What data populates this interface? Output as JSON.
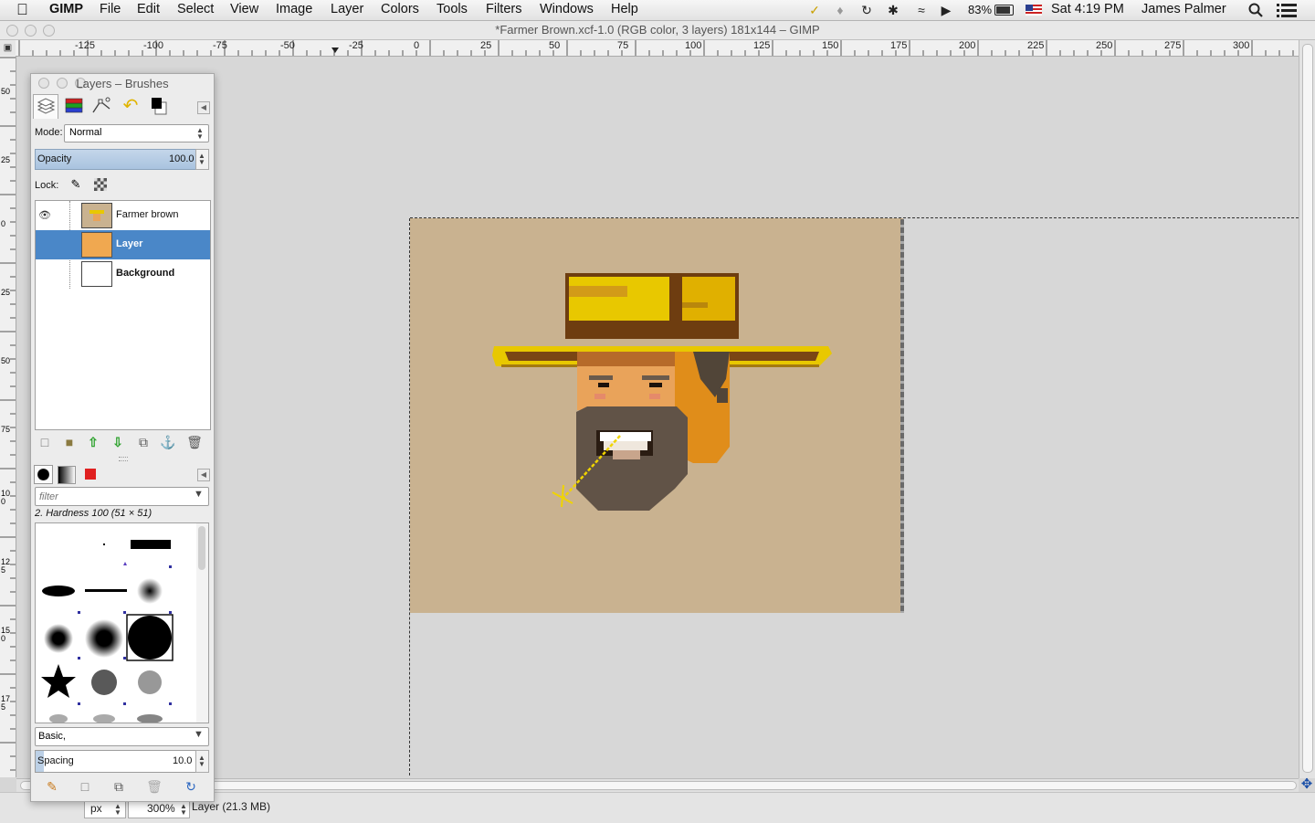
{
  "menubar": {
    "app": "GIMP",
    "items": [
      "File",
      "Edit",
      "Select",
      "View",
      "Image",
      "Layer",
      "Colors",
      "Tools",
      "Filters",
      "Windows",
      "Help"
    ],
    "battery": "83%",
    "clock": "Sat 4:19 PM",
    "user": "James Palmer"
  },
  "window": {
    "title": "*Farmer Brown.xcf-1.0 (RGB color, 3 layers) 181x144 – GIMP"
  },
  "ruler": {
    "labels": [
      "-125",
      "-100",
      "-75",
      "-50",
      "-25",
      "0",
      "25",
      "50",
      "75",
      "100",
      "125",
      "150",
      "175",
      "200",
      "225",
      "250",
      "275",
      "300"
    ],
    "vertical_labels": [
      "50",
      "25",
      "0",
      "25",
      "50",
      "75",
      "100",
      "125",
      "150",
      "175"
    ]
  },
  "dock": {
    "title": "Layers – Brushes",
    "mode_label": "Mode:",
    "mode_value": "Normal",
    "opacity_label": "Opacity",
    "opacity_value": "100.0",
    "lock_label": "Lock:",
    "layers": [
      {
        "name": "Farmer brown",
        "visible": true,
        "selected": false
      },
      {
        "name": "Layer",
        "visible": false,
        "selected": true
      },
      {
        "name": "Background",
        "visible": false,
        "selected": false
      }
    ],
    "filter_placeholder": "filter",
    "brush_name": "2. Hardness 100 (51 × 51)",
    "brush_tag": "Basic,",
    "spacing_label": "Spacing",
    "spacing_value": "10.0"
  },
  "statusbar": {
    "unit": "px",
    "zoom": "300%",
    "message": "Layer (21.3 MB)"
  },
  "icons": {
    "apple": "apple-logo-icon",
    "layer_tab": "layers-icon",
    "channels_tab": "channels-icon",
    "paths_tab": "paths-icon",
    "undo_tab": "undo-history-icon",
    "colors_tab": "fg-bg-colors-icon"
  },
  "colors": {
    "image_background": "#c9b290",
    "selected_layer": "#4a87c8",
    "hat_yellow": "#e8c800",
    "skin": "#e9a35a"
  }
}
